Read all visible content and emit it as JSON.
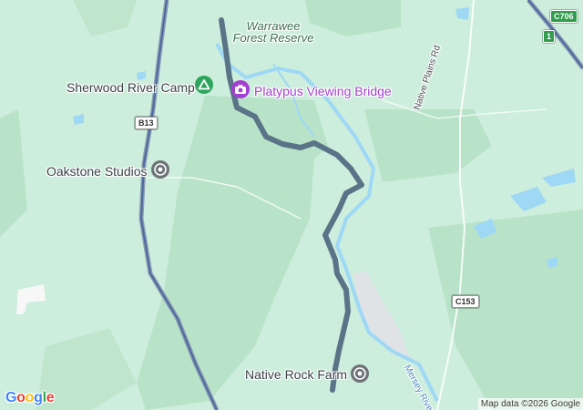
{
  "places": {
    "sherwood": "Sherwood River Camp",
    "platypus": "Platypus Viewing Bridge",
    "oakstone": "Oakstone Studios",
    "native_rock": "Native Rock Farm"
  },
  "area_label": "Warrawee\nForest Reserve",
  "roads": {
    "native_plains": "Native Plains Rd",
    "b13": "B13",
    "c706": "C706",
    "one": "1",
    "c153": "C153"
  },
  "river_label": "Mersey River",
  "attribution": "Map data ©2026 Google",
  "logo": {
    "letters": [
      "G",
      "o",
      "o",
      "g",
      "l",
      "e"
    ],
    "colors": [
      "#4285F4",
      "#EA4335",
      "#FBBC05",
      "#4285F4",
      "#34A853",
      "#EA4335"
    ]
  },
  "colors": {
    "land": "#cdeedd",
    "forest": "#b8e3c8",
    "water": "#9fd8f5",
    "route": "#5a7387",
    "poi_green": "#2ea55c",
    "poi_gray": "#6e7378",
    "poi_purple": "#a33fd1"
  },
  "icons": {
    "camp": "campground-icon",
    "camera": "camera-icon",
    "place": "place-icon"
  }
}
